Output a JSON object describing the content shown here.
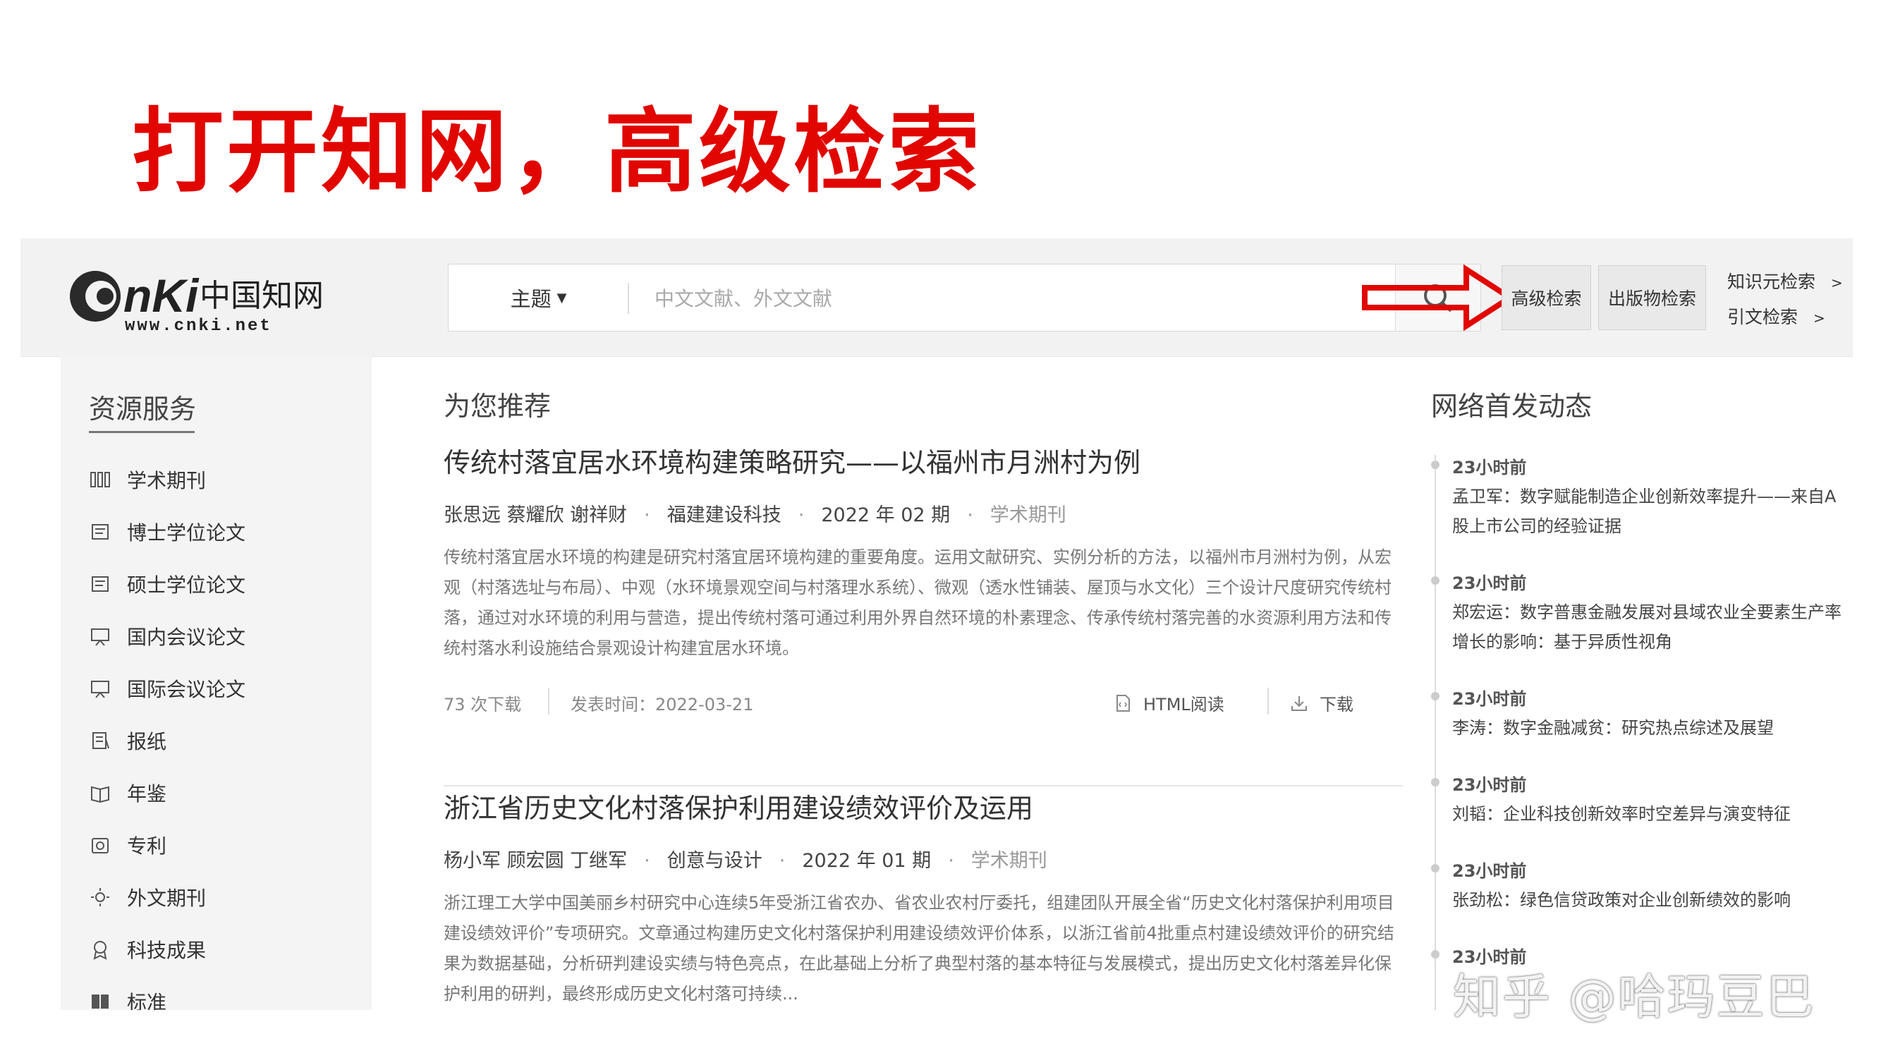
{
  "slide": {
    "title": "打开知网，高级检索"
  },
  "header": {
    "logo_text": "CNKi中国知网",
    "logo_url_text": "www.cnki.net",
    "search_type": "主题",
    "search_placeholder": "中文文献、外文文献",
    "advanced_search": "高级检索",
    "publication_search": "出版物检索",
    "knowledge_search": "知识元检索",
    "citation_search": "引文检索",
    "chevron": ">"
  },
  "sidebar": {
    "title": "资源服务",
    "items": [
      {
        "label": "学术期刊",
        "icon": "journal-icon"
      },
      {
        "label": "博士学位论文",
        "icon": "thesis-icon"
      },
      {
        "label": "硕士学位论文",
        "icon": "thesis-icon"
      },
      {
        "label": "国内会议论文",
        "icon": "conference-icon"
      },
      {
        "label": "国际会议论文",
        "icon": "conference-icon"
      },
      {
        "label": "报纸",
        "icon": "newspaper-icon"
      },
      {
        "label": "年鉴",
        "icon": "yearbook-icon"
      },
      {
        "label": "专利",
        "icon": "patent-icon"
      },
      {
        "label": "外文期刊",
        "icon": "foreign-journal-icon"
      },
      {
        "label": "科技成果",
        "icon": "achievement-icon"
      },
      {
        "label": "标准",
        "icon": "standard-icon"
      }
    ]
  },
  "main": {
    "section_title": "为您推荐",
    "articles": [
      {
        "title": "传统村落宜居水环境构建策略研究——以福州市月洲村为例",
        "authors": "张思远 蔡耀欣 谢祥财",
        "source": "福建建设科技",
        "issue": "2022 年 02 期",
        "type": "学术期刊",
        "abstract": "传统村落宜居水环境的构建是研究村落宜居环境构建的重要角度。运用文献研究、实例分析的方法，以福州市月洲村为例，从宏观（村落选址与布局）、中观（水环境景观空间与村落理水系统）、微观（透水性铺装、屋顶与水文化）三个设计尺度研究传统村落，通过对水环境的利用与营造，提出传统村落可通过利用外界自然环境的朴素理念、传承传统村落完善的水资源利用方法和传统村落水利设施结合景观设计构建宜居水环境。",
        "downloads": "73 次下载",
        "published": "发表时间：2022-03-21",
        "html_read": "HTML阅读",
        "download": "下载"
      },
      {
        "title": "浙江省历史文化村落保护利用建设绩效评价及运用",
        "authors": "杨小军 顾宏圆 丁继军",
        "source": "创意与设计",
        "issue": "2022 年 01 期",
        "type": "学术期刊",
        "abstract": "浙江理工大学中国美丽乡村研究中心连续5年受浙江省农办、省农业农村厅委托，组建团队开展全省“历史文化村落保护利用项目建设绩效评价”专项研究。文章通过构建历史文化村落保护利用建设绩效评价体系，以浙江省前4批重点村建设绩效评价的研究结果为数据基础，分析研判建设实绩与特色亮点，在此基础上分析了典型村落的基本特征与发展模式，提出历史文化村落差异化保护利用的研判，最终形成历史文化村落可持续..."
      }
    ]
  },
  "news": {
    "title": "网络首发动态",
    "items": [
      {
        "time": "23小时前",
        "text": "孟卫军：数字赋能制造企业创新效率提升——来自A股上市公司的经验证据"
      },
      {
        "time": "23小时前",
        "text": "郑宏运：数字普惠金融发展对县域农业全要素生产率增长的影响：基于异质性视角"
      },
      {
        "time": "23小时前",
        "text": "李涛：数字金融减贫：研究热点综述及展望"
      },
      {
        "time": "23小时前",
        "text": "刘韬：企业科技创新效率时空差异与演变特征"
      },
      {
        "time": "23小时前",
        "text": "张劲松：绿色信贷政策对企业创新绩效的影响"
      },
      {
        "time": "23小时前",
        "text": ""
      }
    ]
  },
  "watermark": "知乎 @哈玛豆巴"
}
